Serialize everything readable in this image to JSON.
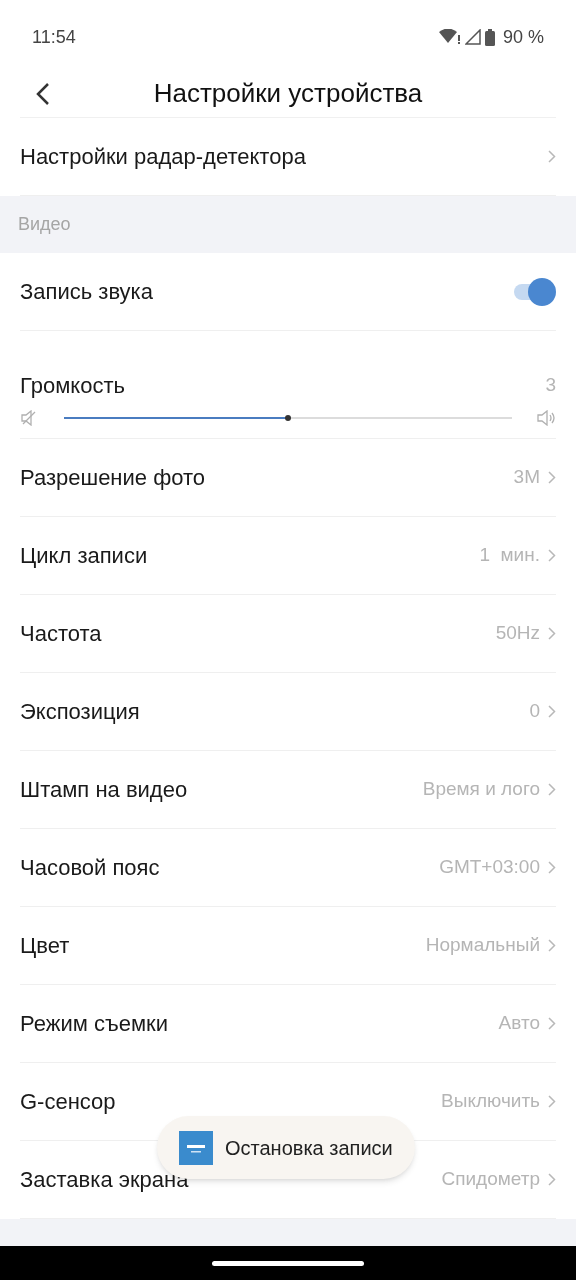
{
  "status_bar": {
    "time": "11:54",
    "battery": "90 %"
  },
  "header": {
    "title": "Настройки устройства"
  },
  "top_rows": [
    {
      "kind": "link",
      "label": "Настройки радар-детектора"
    }
  ],
  "section": {
    "title": "Видео"
  },
  "rows": [
    {
      "kind": "toggle",
      "label": "Запись звука",
      "on": true
    },
    {
      "kind": "slider",
      "label": "Громкость",
      "value": "3",
      "level": 0.5
    },
    {
      "kind": "link",
      "label": "Разрешение фото",
      "value": "3M"
    },
    {
      "kind": "link",
      "label": "Цикл записи",
      "value": "1  мин."
    },
    {
      "kind": "link",
      "label": "Частота",
      "value": "50Hz"
    },
    {
      "kind": "link",
      "label": "Экспозиция",
      "value": "0"
    },
    {
      "kind": "link",
      "label": "Штамп на видео",
      "value": "Время и лого"
    },
    {
      "kind": "link",
      "label": "Часовой пояс",
      "value": "GMT+03:00"
    },
    {
      "kind": "link",
      "label": "Цвет",
      "value": "Нормальный"
    },
    {
      "kind": "link",
      "label": "Режим съемки",
      "value": "Авто"
    },
    {
      "kind": "link",
      "label": "G-сенсор",
      "value": "Выключить"
    },
    {
      "kind": "link",
      "label": "Заставка экрана",
      "value": "Спидометр"
    }
  ],
  "toast": {
    "text": "Остановка записи"
  }
}
